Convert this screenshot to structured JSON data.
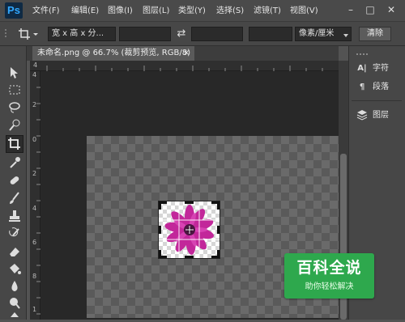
{
  "app": {
    "logo": "Ps"
  },
  "menu": {
    "items": [
      "文件(F)",
      "编辑(E)",
      "图像(I)",
      "图层(L)",
      "类型(Y)",
      "选择(S)",
      "滤镜(T)",
      "视图(V)"
    ]
  },
  "window_controls": {
    "minimize": "–",
    "maximize": "□",
    "close": "✕"
  },
  "options": {
    "ratio_value": "宽 x 高 x 分...",
    "width_value": "",
    "swap_glyph": "⇄",
    "height_value": "",
    "resolution_value": "",
    "unit_value": "像素/厘米",
    "clear_label": "清除"
  },
  "document": {
    "tab_title": "未命名.png @ 66.7% (裁剪预览, RGB/8)",
    "tab_close": "×",
    "ruler_h_label": "4",
    "ruler_v_labels": [
      "4",
      "2",
      "0",
      "2",
      "4",
      "6",
      "8",
      "1"
    ]
  },
  "panels": {
    "character": "字符",
    "paragraph": "段落",
    "layers": "图层"
  },
  "watermark": {
    "title": "百科全说",
    "subtitle": "助你轻松解决"
  },
  "colors": {
    "accent_watermark": "#2ea84d",
    "ps_blue": "#31a8ff",
    "flower": "#c2279a"
  }
}
